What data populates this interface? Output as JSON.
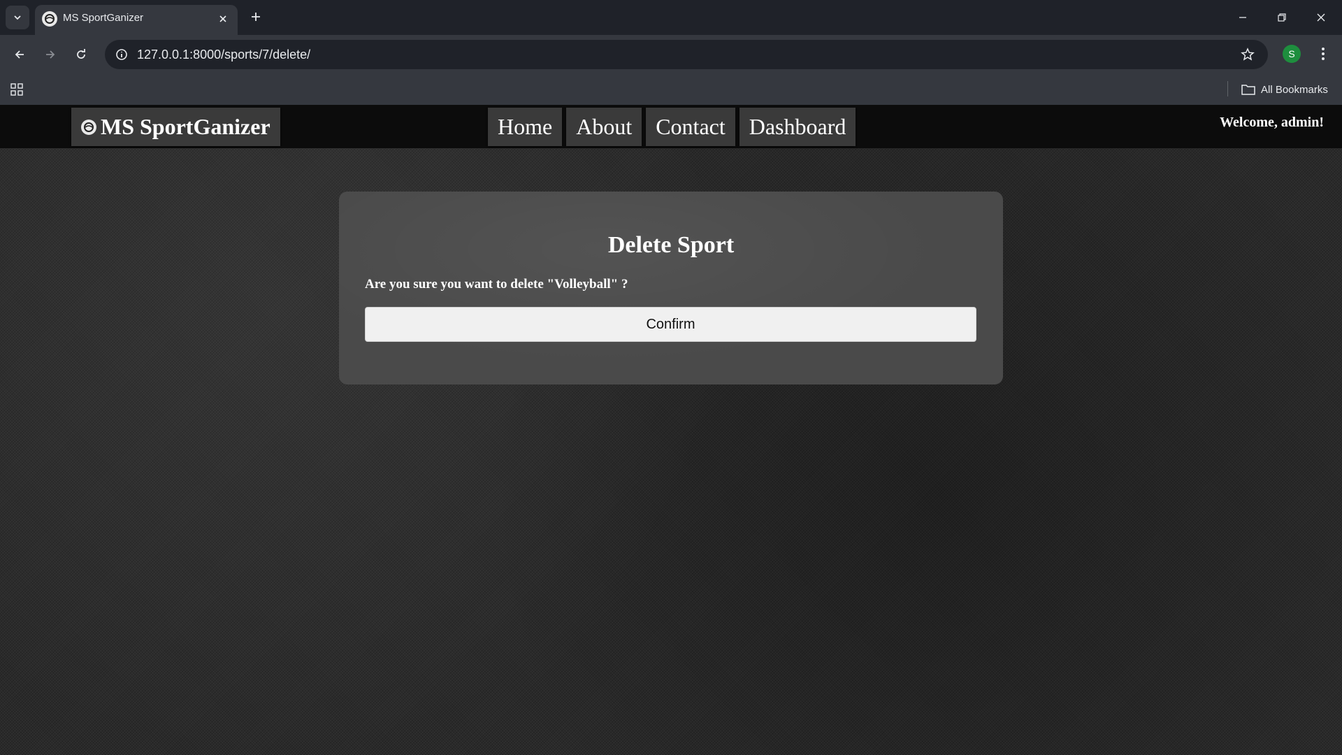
{
  "browser": {
    "tab": {
      "title": "MS SportGanizer",
      "favicon": "sportganizer-logo-icon"
    },
    "url": "127.0.0.1:8000/sports/7/delete/",
    "profile_initial": "S",
    "bookmarks": {
      "all_label": "All Bookmarks"
    },
    "colors": {
      "frame": "#1f2229",
      "toolbar": "#35383f",
      "profile": "#1e8e3e"
    }
  },
  "site": {
    "brand": "MS SportGanizer",
    "nav": [
      {
        "label": "Home"
      },
      {
        "label": "About"
      },
      {
        "label": "Contact"
      },
      {
        "label": "Dashboard"
      }
    ],
    "welcome": "Welcome, admin!"
  },
  "dialog": {
    "title": "Delete Sport",
    "message": "Are you sure you want to delete \"Volleyball\" ?",
    "confirm_label": "Confirm"
  }
}
